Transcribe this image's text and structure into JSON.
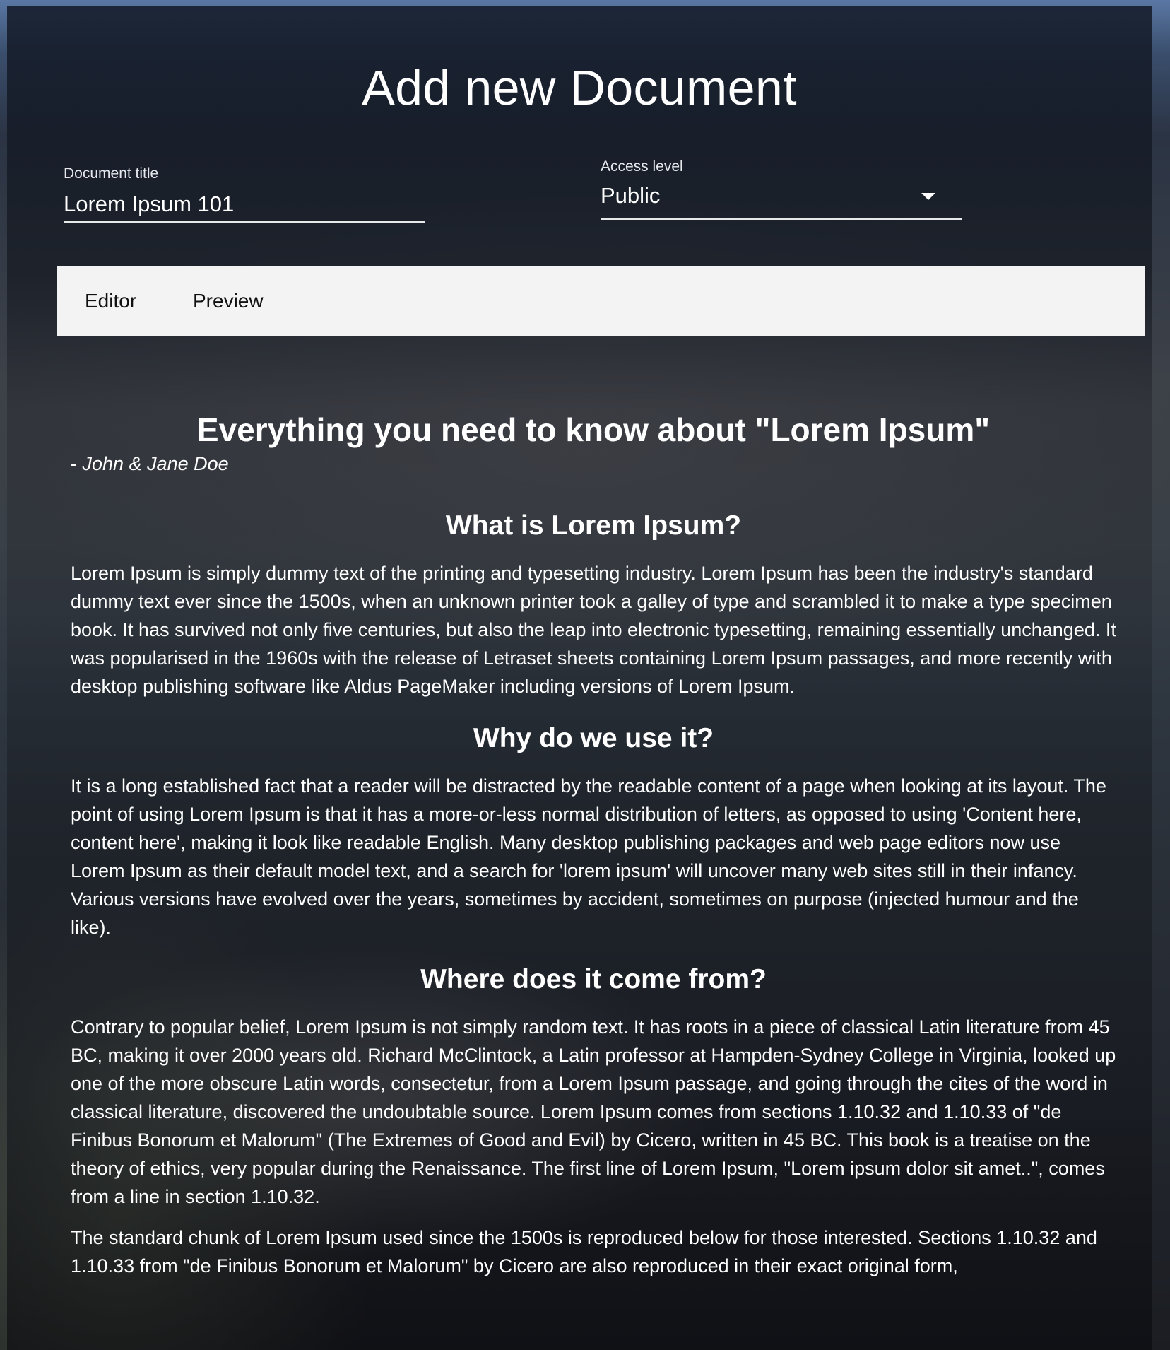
{
  "page": {
    "title": "Add new Document"
  },
  "form": {
    "document_title": {
      "label": "Document title",
      "value": "Lorem Ipsum 101"
    },
    "access_level": {
      "label": "Access level",
      "value": "Public",
      "icon": "arrow-drop-down-icon"
    }
  },
  "tabs": [
    {
      "label": "Editor"
    },
    {
      "label": "Preview"
    }
  ],
  "preview": {
    "heading": "Everything you need to know about \"Lorem Ipsum\"",
    "author_prefix": "-",
    "author": "John & Jane Doe",
    "sections": [
      {
        "heading": "What is Lorem Ipsum?",
        "paragraphs": [
          "Lorem Ipsum is simply dummy text of the printing and typesetting industry. Lorem Ipsum has been the industry's standard dummy text ever since the 1500s, when an unknown printer took a galley of type and scrambled it to make a type specimen book. It has survived not only five centuries, but also the leap into electronic typesetting, remaining essentially unchanged. It was popularised in the 1960s with the release of Letraset sheets containing Lorem Ipsum passages, and more recently with desktop publishing software like Aldus PageMaker including versions of Lorem Ipsum."
        ]
      },
      {
        "heading": "Why do we use it?",
        "paragraphs": [
          "It is a long established fact that a reader will be distracted by the readable content of a page when looking at its layout. The point of using Lorem Ipsum is that it has a more-or-less normal distribution of letters, as opposed to using 'Content here, content here', making it look like readable English. Many desktop publishing packages and web page editors now use Lorem Ipsum as their default model text, and a search for 'lorem ipsum' will uncover many web sites still in their infancy. Various versions have evolved over the years, sometimes by accident, sometimes on purpose (injected humour and the like)."
        ]
      },
      {
        "heading": "Where does it come from?",
        "paragraphs": [
          "Contrary to popular belief, Lorem Ipsum is not simply random text. It has roots in a piece of classical Latin literature from 45 BC, making it over 2000 years old. Richard McClintock, a Latin professor at Hampden-Sydney College in Virginia, looked up one of the more obscure Latin words, consectetur, from a Lorem Ipsum passage, and going through the cites of the word in classical literature, discovered the undoubtable source. Lorem Ipsum comes from sections 1.10.32 and 1.10.33 of \"de Finibus Bonorum et Malorum\" (The Extremes of Good and Evil) by Cicero, written in 45 BC. This book is a treatise on the theory of ethics, very popular during the Renaissance. The first line of Lorem Ipsum, \"Lorem ipsum dolor sit amet..\", comes from a line in section 1.10.32.",
          "The standard chunk of Lorem Ipsum used since the 1500s is reproduced below for those interested. Sections 1.10.32 and 1.10.33 from \"de Finibus Bonorum et Malorum\" by Cicero are also reproduced in their exact original form,"
        ]
      }
    ]
  }
}
